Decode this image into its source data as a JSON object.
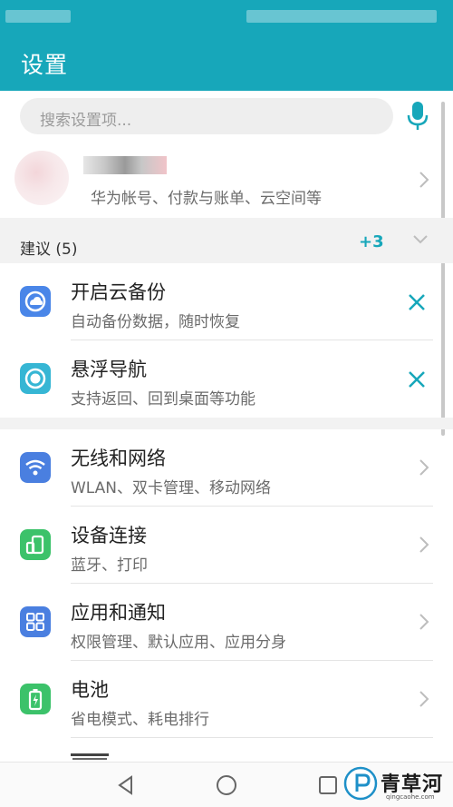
{
  "app": {
    "title": "设置"
  },
  "search": {
    "placeholder": "搜索设置项..."
  },
  "account": {
    "subtitle": "华为帐号、付款与账单、云空间等"
  },
  "suggestions": {
    "header": "建议 (5)",
    "more_count": "+3",
    "items": [
      {
        "title": "开启云备份",
        "subtitle": "自动备份数据，随时恢复",
        "icon": "cloud-backup-icon",
        "color": "#4a86e8"
      },
      {
        "title": "悬浮导航",
        "subtitle": "支持返回、回到桌面等功能",
        "icon": "floating-dock-icon",
        "color": "#36b6d4"
      }
    ]
  },
  "settings": {
    "items": [
      {
        "title": "无线和网络",
        "subtitle": "WLAN、双卡管理、移动网络",
        "icon": "wifi-icon",
        "color": "#4a7fe0"
      },
      {
        "title": "设备连接",
        "subtitle": "蓝牙、打印",
        "icon": "device-connect-icon",
        "color": "#3cc26a"
      },
      {
        "title": "应用和通知",
        "subtitle": "权限管理、默认应用、应用分身",
        "icon": "apps-icon",
        "color": "#4a7fe0"
      },
      {
        "title": "电池",
        "subtitle": "省电模式、耗电排行",
        "icon": "battery-icon",
        "color": "#3cc26a"
      }
    ]
  },
  "colors": {
    "accent": "#17a7ba"
  },
  "watermark": {
    "text": "青草河",
    "url": "qingcaohe.com"
  }
}
